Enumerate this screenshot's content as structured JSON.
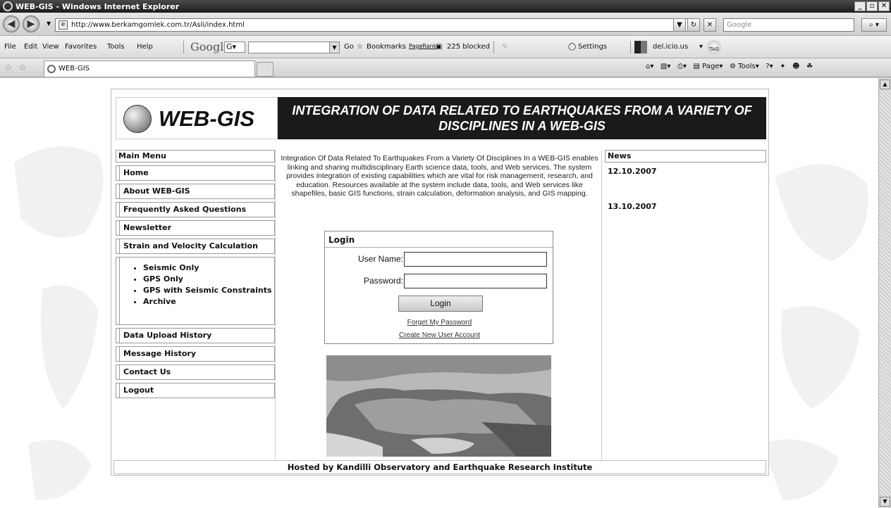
{
  "window": {
    "title": "WEB-GIS - Windows Internet Explorer",
    "buttons": [
      "_",
      "▫",
      "✕"
    ]
  },
  "address": {
    "url": "http://www.berkamgomlek.com.tr/Asli/index.html",
    "search_placeholder": "Google"
  },
  "menubar": {
    "items": [
      "File",
      "Edit",
      "View",
      "Favorites",
      "Tools",
      "Help"
    ],
    "google_logo": "Google",
    "google_box": "G",
    "go": "Go",
    "bookmarks": "Bookmarks",
    "pagerank": "PageRank",
    "blocked": "225 blocked",
    "settings": "Settings",
    "delicious": "del.icio.us",
    "tag": "TAG"
  },
  "tabs": {
    "active_tab": "WEB-GIS",
    "commands": {
      "page": "Page",
      "tools": "Tools"
    }
  },
  "site": {
    "logo_text": "WEB-GIS",
    "banner": "INTEGRATION OF DATA RELATED TO EARTHQUAKES FROM A VARIETY OF DISCIPLINES IN A WEB-GIS",
    "main_menu_title": "Main Menu",
    "menu_top": [
      "Home",
      "About WEB-GIS",
      "Frequently Asked Questions",
      "Newsletter",
      "Strain and Velocity Calculation"
    ],
    "submenu": [
      "Seismic Only",
      "GPS Only",
      "GPS with Seismic Constraints",
      "Archive"
    ],
    "menu_bottom": [
      "Data Upload History",
      "Message History",
      "Contact Us",
      "Logout"
    ],
    "intro": "Integration Of Data Related To Earthquakes From a Variety Of Disciplines In a WEB-GIS enables linking and sharing multidisciplinary Earth science data, tools, and Web services. The system provides integration of existing capabilities which are vital for risk management, research, and education. Resources available at the system include data, tools, and Web services like shapefiles, basic GIS functions, strain calculation, deformation analysis, and GIS mapping.",
    "login": {
      "title": "Login",
      "username_label": "User Name:",
      "password_label": "Password:",
      "username_value": "",
      "password_value": "",
      "button": "Login",
      "forgot": "Forget My Password",
      "create": "Create New User Account"
    },
    "news": {
      "title": "News",
      "dates": [
        "12.10.2007",
        "13.10.2007"
      ]
    },
    "footer": "Hosted by Kandilli Observatory and Earthquake Research Institute"
  }
}
